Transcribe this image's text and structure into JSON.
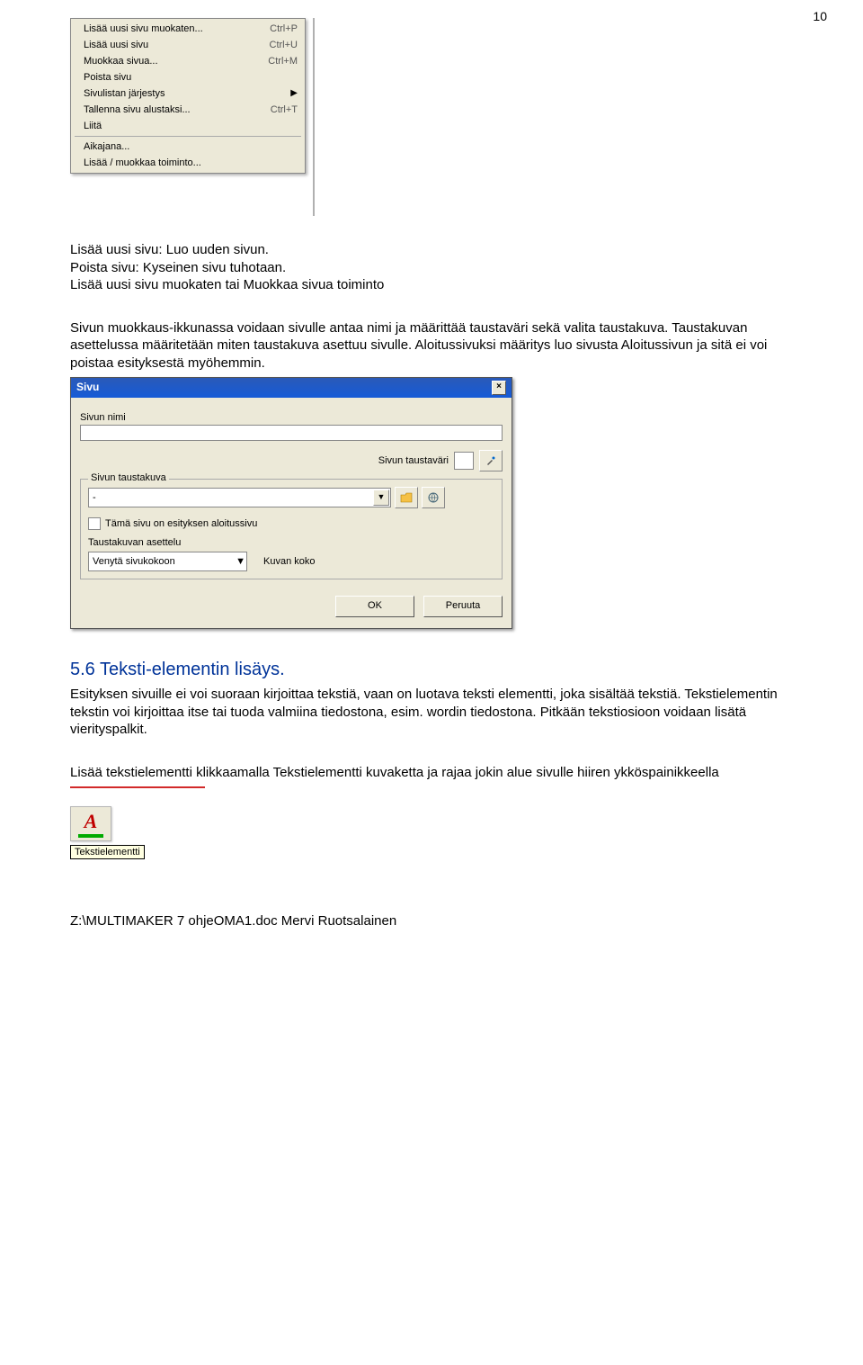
{
  "page_number": "10",
  "menu": {
    "items": [
      {
        "label": "Lisää uusi sivu muokaten...",
        "shortcut": "Ctrl+P"
      },
      {
        "label": "Lisää uusi sivu",
        "shortcut": "Ctrl+U"
      },
      {
        "label": "Muokkaa sivua...",
        "shortcut": "Ctrl+M"
      },
      {
        "label": "Poista sivu",
        "shortcut": ""
      },
      {
        "label": "Sivulistan järjestys",
        "shortcut": "",
        "arrow": true
      },
      {
        "label": "Tallenna sivu alustaksi...",
        "shortcut": "Ctrl+T"
      },
      {
        "label": "Liitä",
        "shortcut": ""
      }
    ],
    "after_sep_items": [
      {
        "label": "Aikajana...",
        "shortcut": ""
      },
      {
        "label": "Lisää / muokkaa toiminto...",
        "shortcut": ""
      }
    ]
  },
  "intro": {
    "line1": "Lisää uusi sivu: Luo uuden sivun.",
    "line2": "Poista sivu: Kyseinen sivu tuhotaan.",
    "line3": "Lisää uusi sivu muokaten tai Muokkaa sivua toiminto"
  },
  "desc": "Sivun muokkaus-ikkunassa voidaan sivulle antaa nimi ja määrittää taustaväri sekä valita taustakuva. Taustakuvan asettelussa määritetään miten taustakuva asettuu sivulle. Aloitussivuksi määritys luo sivusta Aloitussivun ja sitä ei voi poistaa esityksestä myöhemmin.",
  "dialog": {
    "title": "Sivu",
    "name_label": "Sivun nimi",
    "name_value": "",
    "bgcolor_label": "Sivun taustaväri",
    "group_title": "Sivun taustakuva",
    "combo1_value": "-",
    "chk_label": "Tämä sivu on esityksen aloitussivu",
    "layout_label": "Taustakuvan asettelu",
    "layout_value": "Venytä sivukokoon",
    "size_label": "Kuvan koko",
    "ok": "OK",
    "cancel": "Peruuta"
  },
  "section": {
    "heading": "5.6 Teksti-elementin lisäys.",
    "body1": "Esityksen sivuille ei voi suoraan kirjoittaa tekstiä, vaan on luotava teksti elementti, joka sisältää tekstiä. Tekstielementin tekstin voi kirjoittaa itse tai tuoda valmiina tiedostona, esim. wordin tiedostona. Pitkään tekstiosioon voidaan lisätä vierityspalkit.",
    "body2": "Lisää tekstielementti klikkaamalla Tekstielementti kuvaketta ja rajaa jokin alue sivulle hiiren ykköspainikkeella"
  },
  "tooltip": "Tekstielementti",
  "footer": "Z:\\MULTIMAKER 7 ohjeOMA1.doc Mervi Ruotsalainen"
}
